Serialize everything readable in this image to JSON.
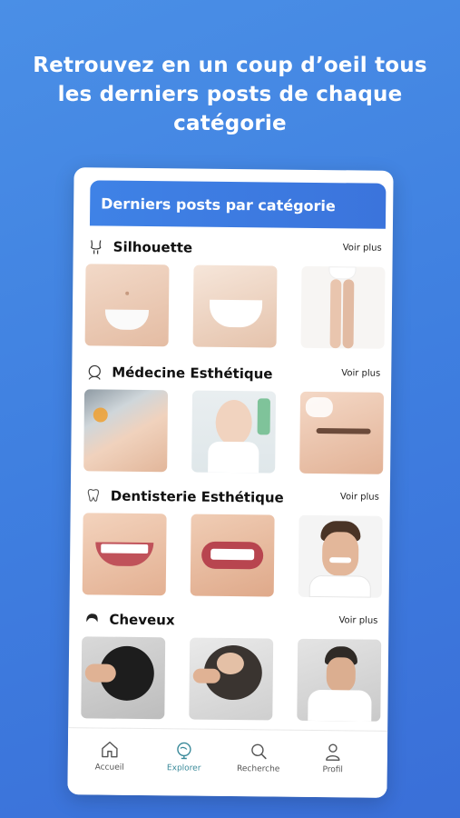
{
  "headline": {
    "line1": "Retrouvez en un coup d’oeil tous",
    "line2": "les derniers posts de chaque",
    "line3": "catégorie"
  },
  "banner": {
    "title": "Derniers posts par catégorie"
  },
  "sections": [
    {
      "title": "Silhouette",
      "more": "Voir plus",
      "icon": "body-silhouette-icon"
    },
    {
      "title": "Médecine Esthétique",
      "more": "Voir plus",
      "icon": "face-icon"
    },
    {
      "title": "Dentisterie Esthétique",
      "more": "Voir plus",
      "icon": "tooth-icon"
    },
    {
      "title": "Cheveux",
      "more": "Voir plus",
      "icon": "hair-icon"
    }
  ],
  "nav": {
    "items": [
      {
        "label": "Accueil",
        "icon": "home-icon"
      },
      {
        "label": "Explorer",
        "icon": "explore-icon",
        "active": true
      },
      {
        "label": "Recherche",
        "icon": "search-icon"
      },
      {
        "label": "Profil",
        "icon": "profile-icon"
      }
    ]
  },
  "colors": {
    "background": "#3f7fe0",
    "banner": "#3f82e6",
    "active_nav": "#3a8a9a"
  }
}
